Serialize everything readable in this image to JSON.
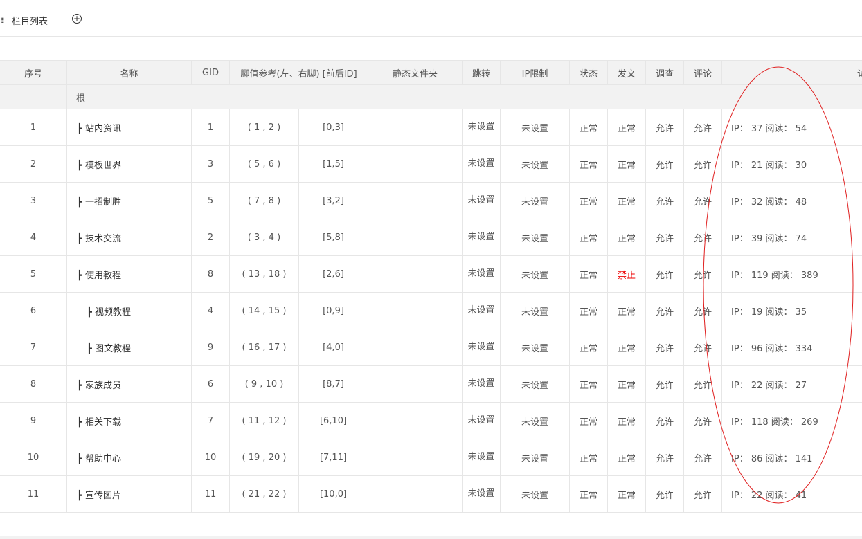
{
  "toolbar": {
    "title": "栏目列表",
    "add_icon": "plus-circle-icon",
    "menu_icon": "grid-dots-icon"
  },
  "table": {
    "headers": [
      "序号",
      "名称",
      "GID",
      "脚值参考(左、右脚) [前后ID]",
      "静态文件夹",
      "跳转",
      "IP限制",
      "状态",
      "发文",
      "调查",
      "评论",
      "访问"
    ],
    "root_label": "根",
    "rows": [
      {
        "index": "1",
        "name": "┣ 站内资讯",
        "gid": "1",
        "ref_lr": "( 1 , 2 )",
        "ref_id": "[0,3]",
        "jump": "未设置",
        "ip_limit": "未设置",
        "status": "正常",
        "publish": "正常",
        "survey": "允许",
        "comment": "允许",
        "access": "IP： 37 阅读： 54"
      },
      {
        "index": "2",
        "name": "┣ 模板世界",
        "gid": "3",
        "ref_lr": "( 5 , 6 )",
        "ref_id": "[1,5]",
        "jump": "未设置",
        "ip_limit": "未设置",
        "status": "正常",
        "publish": "正常",
        "survey": "允许",
        "comment": "允许",
        "access": "IP： 21 阅读： 30"
      },
      {
        "index": "3",
        "name": "┣ 一招制胜",
        "gid": "5",
        "ref_lr": "( 7 , 8 )",
        "ref_id": "[3,2]",
        "jump": "未设置",
        "ip_limit": "未设置",
        "status": "正常",
        "publish": "正常",
        "survey": "允许",
        "comment": "允许",
        "access": "IP： 32 阅读： 48"
      },
      {
        "index": "4",
        "name": "┣ 技术交流",
        "gid": "2",
        "ref_lr": "( 3 , 4 )",
        "ref_id": "[5,8]",
        "jump": "未设置",
        "ip_limit": "未设置",
        "status": "正常",
        "publish": "正常",
        "survey": "允许",
        "comment": "允许",
        "access": "IP： 39 阅读： 74"
      },
      {
        "index": "5",
        "name": "┣ 使用教程",
        "gid": "8",
        "ref_lr": "( 13 , 18 )",
        "ref_id": "[2,6]",
        "jump": "未设置",
        "ip_limit": "未设置",
        "status": "正常",
        "publish": "禁止",
        "survey": "允许",
        "comment": "允许",
        "access": "IP： 119 阅读： 389"
      },
      {
        "index": "6",
        "name": "┣ 视频教程",
        "gid": "4",
        "ref_lr": "( 14 , 15 )",
        "ref_id": "[0,9]",
        "jump": "未设置",
        "ip_limit": "未设置",
        "status": "正常",
        "publish": "正常",
        "survey": "允许",
        "comment": "允许",
        "access": "IP： 19 阅读： 35",
        "child": true
      },
      {
        "index": "7",
        "name": "┣ 图文教程",
        "gid": "9",
        "ref_lr": "( 16 , 17 )",
        "ref_id": "[4,0]",
        "jump": "未设置",
        "ip_limit": "未设置",
        "status": "正常",
        "publish": "正常",
        "survey": "允许",
        "comment": "允许",
        "access": "IP： 96 阅读： 334",
        "child": true
      },
      {
        "index": "8",
        "name": "┣ 家族成员",
        "gid": "6",
        "ref_lr": "( 9 , 10 )",
        "ref_id": "[8,7]",
        "jump": "未设置",
        "ip_limit": "未设置",
        "status": "正常",
        "publish": "正常",
        "survey": "允许",
        "comment": "允许",
        "access": "IP： 22 阅读： 27"
      },
      {
        "index": "9",
        "name": "┣ 相关下载",
        "gid": "7",
        "ref_lr": "( 11 , 12 )",
        "ref_id": "[6,10]",
        "jump": "未设置",
        "ip_limit": "未设置",
        "status": "正常",
        "publish": "正常",
        "survey": "允许",
        "comment": "允许",
        "access": "IP： 118 阅读： 269"
      },
      {
        "index": "10",
        "name": "┣ 帮助中心",
        "gid": "10",
        "ref_lr": "( 19 , 20 )",
        "ref_id": "[7,11]",
        "jump": "未设置",
        "ip_limit": "未设置",
        "status": "正常",
        "publish": "正常",
        "survey": "允许",
        "comment": "允许",
        "access": "IP： 86 阅读： 141"
      },
      {
        "index": "11",
        "name": "┣ 宣传图片",
        "gid": "11",
        "ref_lr": "( 21 , 22 )",
        "ref_id": "[10,0]",
        "jump": "未设置",
        "ip_limit": "未设置",
        "status": "正常",
        "publish": "正常",
        "survey": "允许",
        "comment": "允许",
        "access": "IP： 22 阅读： 41"
      }
    ]
  },
  "colors": {
    "forbid": "#e00000",
    "annotation_ellipse": "#e02020"
  }
}
